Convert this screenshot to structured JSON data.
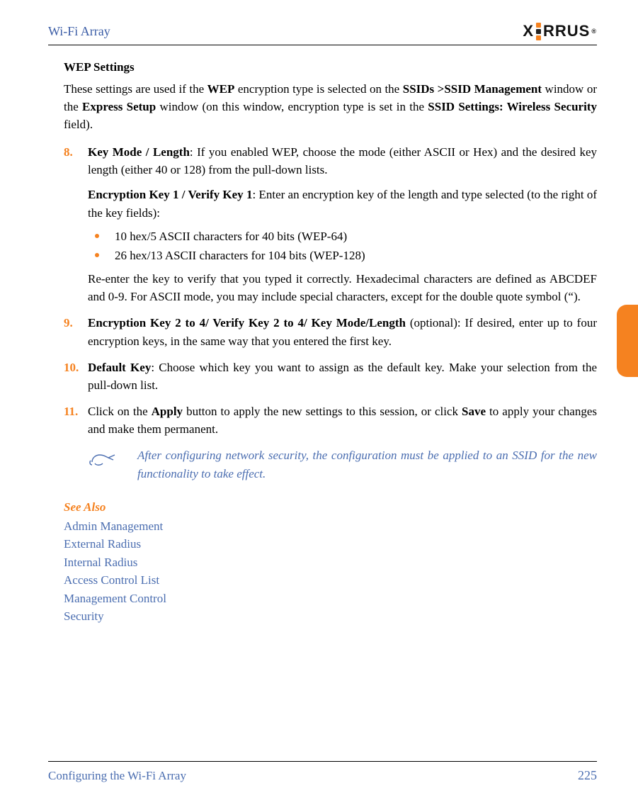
{
  "doc_title": "Wi-Fi Array",
  "logo_text_pre": "X",
  "logo_text_post": "RRUS",
  "heading": "WEP Settings",
  "intro_1a": "These settings are used if the ",
  "intro_1b": "WEP",
  "intro_1c": " encryption type is selected on the ",
  "intro_1d": "SSIDs >SSID Management",
  "intro_1e": " window or the ",
  "intro_1f": "Express Setup",
  "intro_1g": " window (on this window, encryption type is set in the ",
  "intro_1h": "SSID Settings: Wireless Security",
  "intro_1i": " field).",
  "item8_num": "8.",
  "item8_b1": "Key Mode / Length",
  "item8_t1": ": If you enabled WEP, choose the mode (either ASCII or Hex) and the desired key length (either 40 or 128) from the pull-down lists.",
  "item8_b2": "Encryption Key 1 / Verify Key 1",
  "item8_t2": ": Enter an encryption key of the length and type selected (to the right of the key fields):",
  "bullet1": "10 hex/5 ASCII characters for 40 bits (WEP-64)",
  "bullet2": "26 hex/13 ASCII characters for 104 bits (WEP-128)",
  "item8_t3": "Re-enter the key to verify that you typed it correctly. Hexadecimal characters are defined as ABCDEF and 0-9. For ASCII mode, you may include special characters, except for the double quote symbol (“).",
  "item9_num": "9.",
  "item9_b1": "Encryption Key 2 to 4/ Verify Key 2 to 4/ Key Mode/Length",
  "item9_t1": " (optional): If desired, enter up to four encryption keys, in the same way that you entered the first key.",
  "item10_num": "10.",
  "item10_b1": "Default Key",
  "item10_t1": ": Choose which key you want to assign as the default key. Make your selection from the pull-down list.",
  "item11_num": "11.",
  "item11_t1a": "Click on the ",
  "item11_b1": "Apply",
  "item11_t1b": " button to apply the new settings to this session, or click ",
  "item11_b2": "Save",
  "item11_t1c": " to apply your changes and make them permanent.",
  "note_text": "After configuring network security, the configuration must be applied to an SSID for the new functionality to take effect.",
  "see_also_title": "See Also",
  "links": {
    "l1": "Admin Management",
    "l2": "External Radius",
    "l3": "Internal Radius",
    "l4": "Access Control List",
    "l5": "Management Control",
    "l6": "Security"
  },
  "footer_left": "Configuring the Wi-Fi Array",
  "footer_right": "225"
}
